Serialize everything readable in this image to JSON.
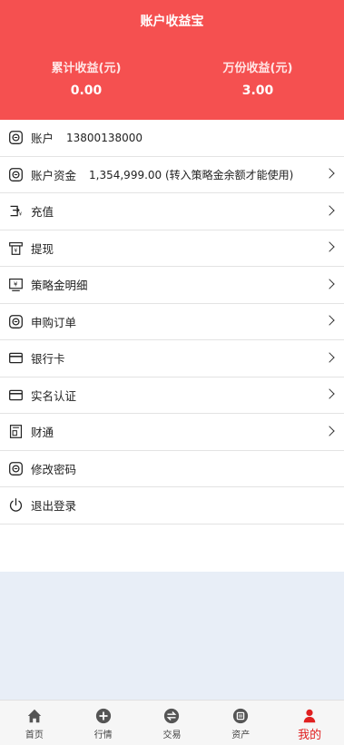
{
  "header": {
    "title": "账户收益宝",
    "cumulative_label": "累计收益(元)",
    "cumulative_value": "0.00",
    "per_10k_label": "万份收益(元)",
    "per_10k_value": "3.00"
  },
  "menu": {
    "account_label": "账户",
    "account_value": "13800138000",
    "funds_label": "账户资金",
    "funds_value": "1,354,999.00 (转入策略金余额才能使用)",
    "recharge": "充值",
    "withdraw": "提现",
    "strategy_detail": "策略金明细",
    "subscription_orders": "申购订单",
    "bank_card": "银行卡",
    "real_name": "实名认证",
    "caitong": "财通",
    "change_password": "修改密码",
    "logout": "退出登录"
  },
  "tabbar": {
    "home": "首页",
    "market": "行情",
    "trade": "交易",
    "assets": "资产",
    "mine": "我的"
  },
  "colors": {
    "header_bg": "#f55050",
    "active_tab": "#e02020",
    "page_bg": "#e8eef7"
  }
}
